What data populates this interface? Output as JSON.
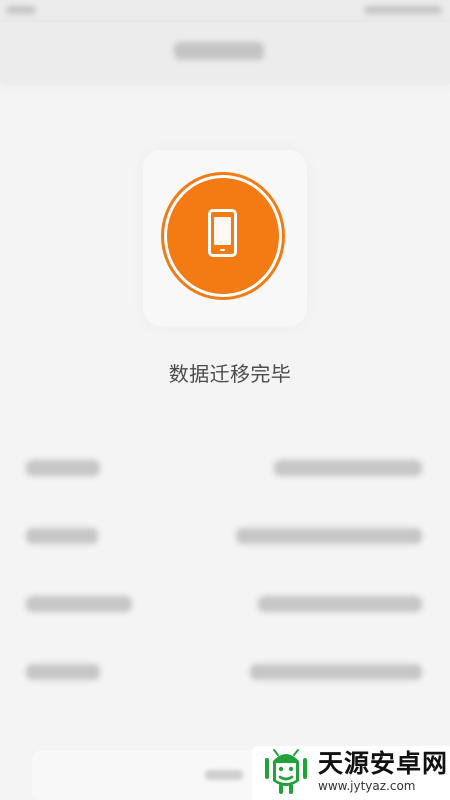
{
  "message": {
    "text": "数据迁移完毕"
  },
  "watermark": {
    "title": "天源安卓网",
    "url": "www.jytyaz.com"
  },
  "colors": {
    "accent": "#f47a14",
    "watermark_green": "#22a23a"
  },
  "icons": {
    "phone": "phone-icon",
    "watermark_logo": "android-logo-icon"
  }
}
